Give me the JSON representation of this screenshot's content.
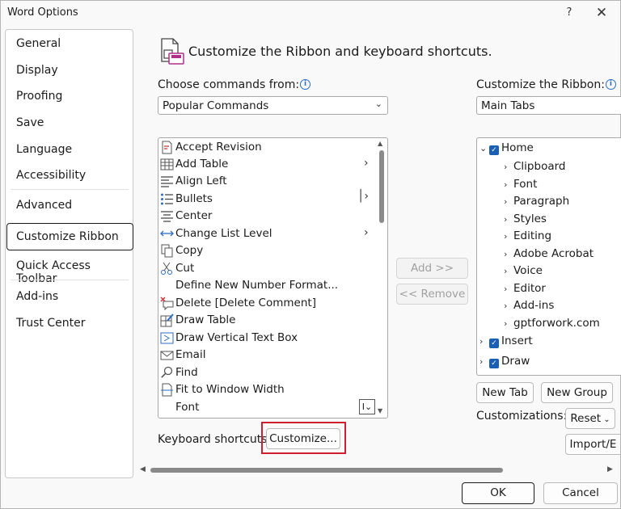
{
  "window": {
    "title": "Word Options",
    "help": "?",
    "close": "✕"
  },
  "nav": {
    "items": [
      "General",
      "Display",
      "Proofing",
      "Save",
      "Language",
      "Accessibility",
      "Advanced",
      "Customize Ribbon",
      "Quick Access Toolbar",
      "Add-ins",
      "Trust Center"
    ],
    "active": "Customize Ribbon"
  },
  "header": {
    "title": "Customize the Ribbon and keyboard shortcuts."
  },
  "left": {
    "choose_label": "Choose commands from:",
    "choose_value": "Popular Commands",
    "commands": [
      {
        "label": "Accept Revision",
        "icon": "accept-revision-icon",
        "arrow": ""
      },
      {
        "label": "Add Table",
        "icon": "table-icon",
        "arrow": ">"
      },
      {
        "label": "Align Left",
        "icon": "align-left-icon",
        "arrow": ""
      },
      {
        "label": "Bullets",
        "icon": "bullets-icon",
        "arrow": "|>"
      },
      {
        "label": "Center",
        "icon": "center-align-icon",
        "arrow": ""
      },
      {
        "label": "Change List Level",
        "icon": "list-level-icon",
        "arrow": ">"
      },
      {
        "label": "Copy",
        "icon": "copy-icon",
        "arrow": ""
      },
      {
        "label": "Cut",
        "icon": "scissors-icon",
        "arrow": ""
      },
      {
        "label": "Define New Number Format...",
        "icon": "",
        "arrow": ""
      },
      {
        "label": "Delete [Delete Comment]",
        "icon": "delete-comment-icon",
        "arrow": ""
      },
      {
        "label": "Draw Table",
        "icon": "draw-table-icon",
        "arrow": ""
      },
      {
        "label": "Draw Vertical Text Box",
        "icon": "text-box-icon",
        "arrow": ""
      },
      {
        "label": "Email",
        "icon": "email-icon",
        "arrow": ""
      },
      {
        "label": "Find",
        "icon": "find-icon",
        "arrow": ""
      },
      {
        "label": "Fit to Window Width",
        "icon": "fit-width-icon",
        "arrow": ""
      },
      {
        "label": "Font",
        "icon": "",
        "arrow": ""
      }
    ],
    "keyboard_label": "Keyboard shortcuts:",
    "customize_button": "Customize..."
  },
  "middle": {
    "add_button": "Add >>",
    "remove_button": "<< Remove"
  },
  "right": {
    "ribbon_label": "Customize the Ribbon:",
    "ribbon_value": "Main Tabs",
    "tree": [
      {
        "label": "Home",
        "level": 0,
        "expanded": true,
        "checked": true
      },
      {
        "label": "Clipboard",
        "level": 1
      },
      {
        "label": "Font",
        "level": 1
      },
      {
        "label": "Paragraph",
        "level": 1
      },
      {
        "label": "Styles",
        "level": 1
      },
      {
        "label": "Editing",
        "level": 1
      },
      {
        "label": "Adobe Acrobat",
        "level": 1
      },
      {
        "label": "Voice",
        "level": 1
      },
      {
        "label": "Editor",
        "level": 1
      },
      {
        "label": "Add-ins",
        "level": 1
      },
      {
        "label": "gptforwork.com",
        "level": 1
      },
      {
        "label": "Insert",
        "level": 0,
        "expanded": false,
        "checked": true
      },
      {
        "label": "Draw",
        "level": 0,
        "expanded": false,
        "checked": true
      }
    ],
    "new_tab_button": "New Tab",
    "new_group_button": "New Group",
    "customizations_label": "Customizations:",
    "reset_button": "Reset",
    "import_button": "Import/E"
  },
  "footer": {
    "ok_button": "OK",
    "cancel_button": "Cancel"
  },
  "colors": {
    "accent": "#1a5fb4",
    "highlight": "#d21f2f"
  }
}
